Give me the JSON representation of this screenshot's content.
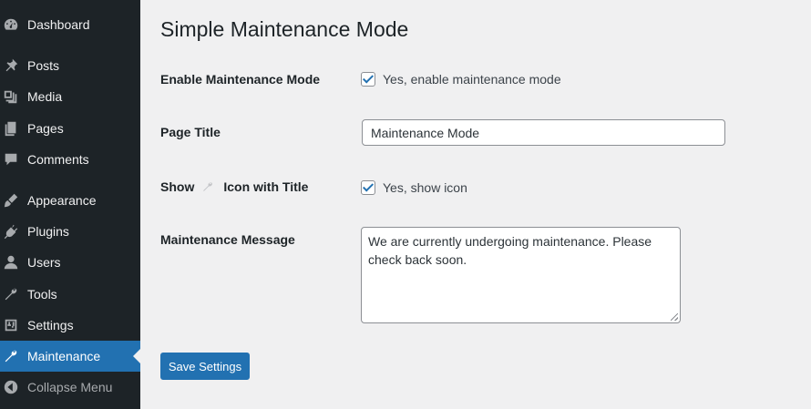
{
  "sidebar": {
    "items": [
      {
        "label": "Dashboard",
        "icon": "dashboard-icon"
      },
      {
        "label": "Posts",
        "icon": "pin-icon"
      },
      {
        "label": "Media",
        "icon": "media-icon"
      },
      {
        "label": "Pages",
        "icon": "pages-icon"
      },
      {
        "label": "Comments",
        "icon": "comment-icon"
      },
      {
        "label": "Appearance",
        "icon": "brush-icon"
      },
      {
        "label": "Plugins",
        "icon": "plug-icon"
      },
      {
        "label": "Users",
        "icon": "user-icon"
      },
      {
        "label": "Tools",
        "icon": "wrench-icon"
      },
      {
        "label": "Settings",
        "icon": "settings-icon"
      },
      {
        "label": "Maintenance",
        "icon": "wrench-icon",
        "active": true
      },
      {
        "label": "Collapse Menu",
        "icon": "collapse-icon"
      }
    ],
    "active_color": "#2271b1",
    "background": "#1d2327"
  },
  "page": {
    "title": "Simple Maintenance Mode"
  },
  "form": {
    "enable": {
      "label": "Enable Maintenance Mode",
      "checkbox_label": "Yes, enable maintenance mode",
      "checked": true
    },
    "page_title": {
      "label": "Page Title",
      "value": "Maintenance Mode"
    },
    "show_icon": {
      "label_before": "Show",
      "label_after": "Icon with Title",
      "icon": "wrench-icon",
      "checkbox_label": "Yes, show icon",
      "checked": true
    },
    "message": {
      "label": "Maintenance Message",
      "value": "We are currently undergoing maintenance. Please check back soon."
    },
    "save_label": "Save Settings"
  }
}
